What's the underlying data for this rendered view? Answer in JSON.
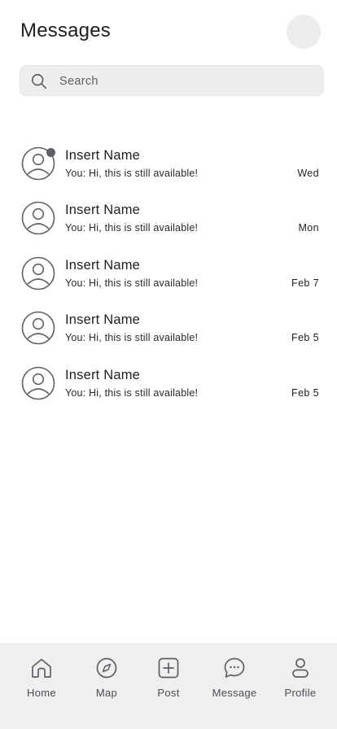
{
  "header": {
    "title": "Messages"
  },
  "search": {
    "placeholder": "Search",
    "icon": "search-icon"
  },
  "conversations": [
    {
      "name": "Insert Name",
      "preview": "You: Hi, this is still available!",
      "date": "Wed",
      "unread": true
    },
    {
      "name": "Insert Name",
      "preview": "You: Hi, this is still available!",
      "date": "Mon",
      "unread": false
    },
    {
      "name": "Insert Name",
      "preview": "You: Hi, this is still available!",
      "date": "Feb 7",
      "unread": false
    },
    {
      "name": "Insert Name",
      "preview": "You: Hi, this is still available!",
      "date": "Feb 5",
      "unread": false
    },
    {
      "name": "Insert Name",
      "preview": "You: Hi, this is still available!",
      "date": "Feb 5",
      "unread": false
    }
  ],
  "tabbar": {
    "items": [
      {
        "label": "Home",
        "icon": "home-icon"
      },
      {
        "label": "Map",
        "icon": "compass-icon"
      },
      {
        "label": "Post",
        "icon": "plus-square-icon"
      },
      {
        "label": "Message",
        "icon": "chat-bubble-icon"
      },
      {
        "label": "Profile",
        "icon": "person-icon"
      }
    ]
  },
  "colors": {
    "icon": "#5f5f66",
    "tabbar_bg": "#efefef",
    "search_bg": "#eeeeee"
  }
}
